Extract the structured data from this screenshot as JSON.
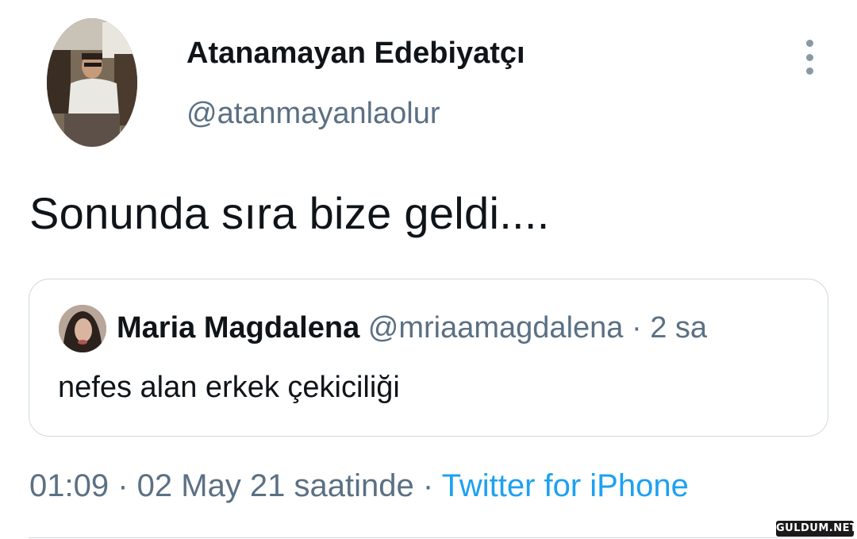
{
  "tweet": {
    "author": {
      "display_name": "Atanamayan Edebiyatçı",
      "handle": "@atanmayanlaolur"
    },
    "more_icon": "more-vertical-icon",
    "text": "Sonunda sıra bize geldi....",
    "quote": {
      "display_name": "Maria Magdalena",
      "handle": "@mriaamagdalena",
      "separator": " · ",
      "time": "2 sa",
      "text": "nefes alan erkek çekiciliği"
    },
    "meta": {
      "timestamp": "01:09 · 02 May 21 saatinde",
      "separator": " · ",
      "source": "Twitter for iPhone"
    }
  },
  "watermark": "GULDUM.NET",
  "colors": {
    "text_primary": "#0f1419",
    "text_secondary": "#5b7083",
    "link": "#1da1f2",
    "border": "#cfd9de"
  }
}
